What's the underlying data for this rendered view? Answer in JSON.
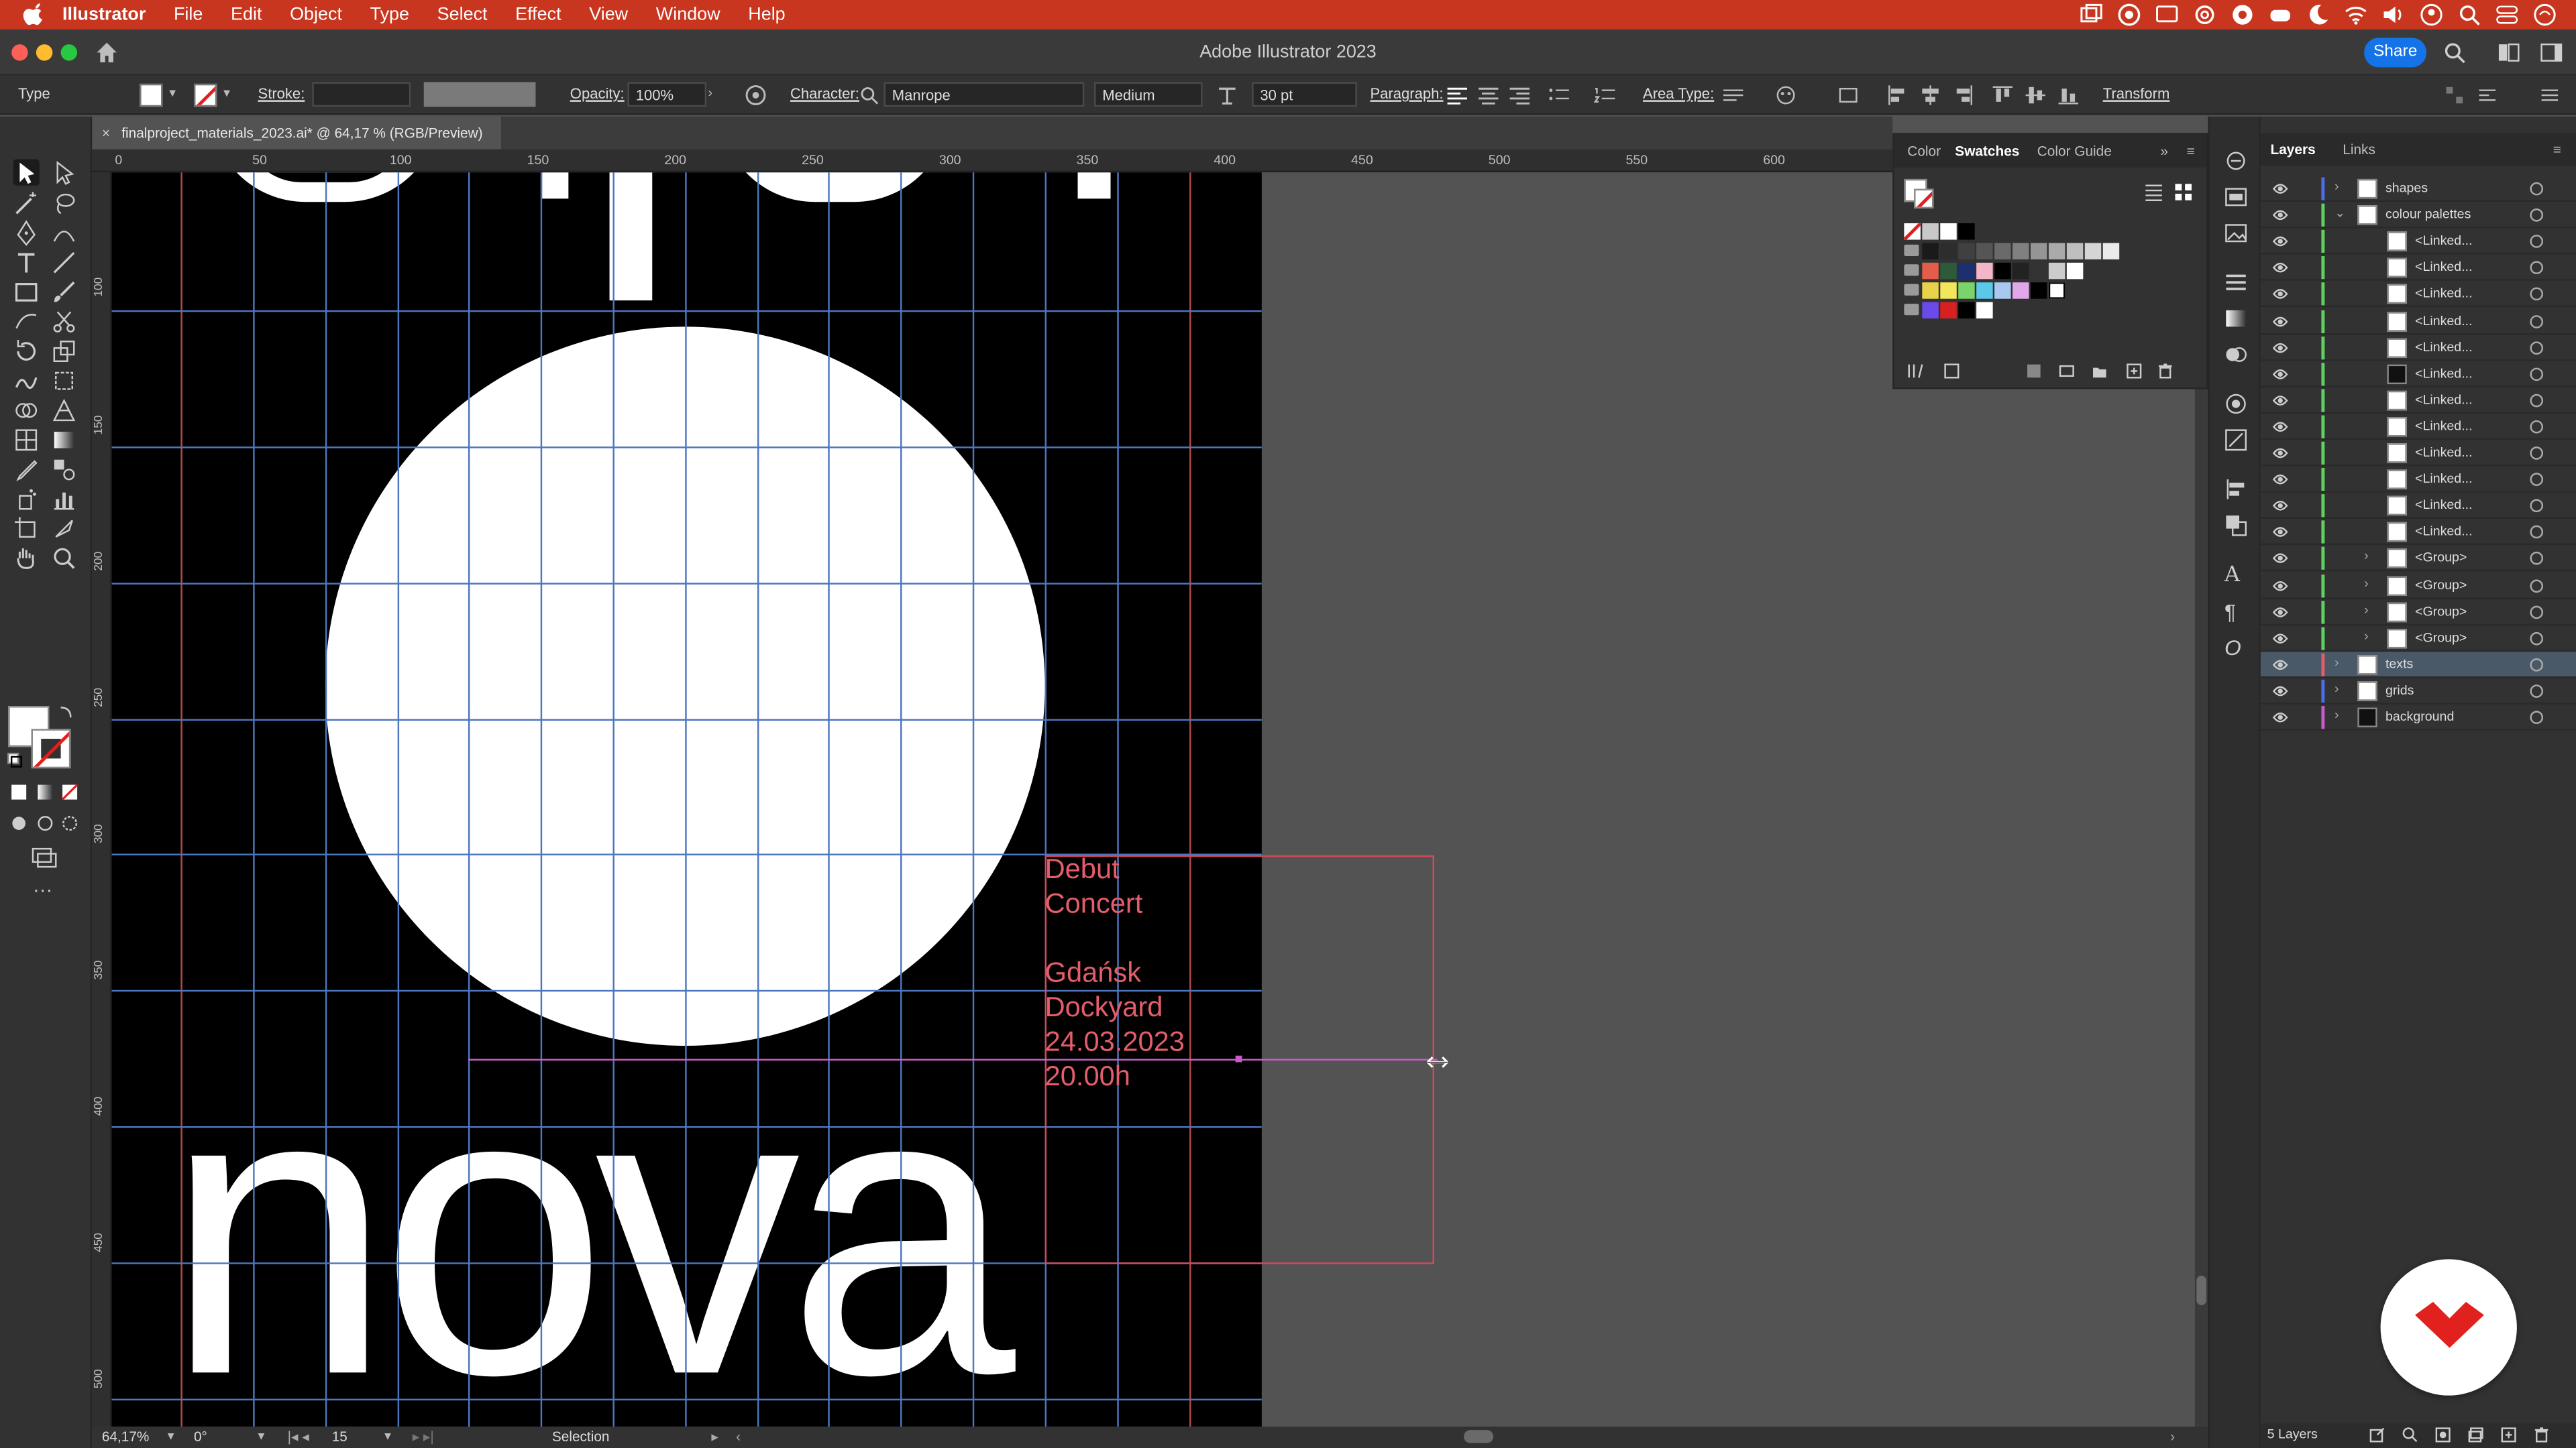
{
  "menubar": {
    "app": "Illustrator",
    "items": [
      "File",
      "Edit",
      "Object",
      "Type",
      "Select",
      "Effect",
      "View",
      "Window",
      "Help"
    ]
  },
  "window": {
    "title": "Adobe Illustrator 2023",
    "share": "Share"
  },
  "control": {
    "tool": "Type",
    "stroke": "Stroke:",
    "opacity_label": "Opacity:",
    "opacity": "100%",
    "character_label": "Character:",
    "font": "Manrope",
    "weight": "Medium",
    "size": "30 pt",
    "paragraph_label": "Paragraph:",
    "area_type_label": "Area Type:",
    "transform": "Transform"
  },
  "document": {
    "tab": "finalproject_materials_2023.ai* @ 64,17 % (RGB/Preview)"
  },
  "ruler": {
    "h_ticks": [
      "0",
      "50",
      "100",
      "150",
      "200",
      "250",
      "300",
      "350",
      "400",
      "450",
      "500",
      "550",
      "600"
    ]
  },
  "artwork": {
    "headline": "nova",
    "lines": [
      "Debut",
      "Concert",
      "",
      "Gdańsk",
      "Dockyard",
      "24.03.2023",
      "20.00h"
    ]
  },
  "status": {
    "zoom": "64,17%",
    "rotation": "0°",
    "artboard": "15",
    "tool": "Selection"
  },
  "swatches": {
    "tabs": [
      "Color",
      "Swatches",
      "Color Guide"
    ]
  },
  "layers": {
    "tabs": [
      "Layers",
      "Links"
    ],
    "footer": "5 Layers",
    "rows": [
      {
        "name": "shapes",
        "indent": 0,
        "expand": "›",
        "color": "#4c6ee6",
        "thumb": "light"
      },
      {
        "name": "colour palettes",
        "indent": 0,
        "expand": "⌄",
        "color": "#5fd35f",
        "thumb": "light"
      },
      {
        "name": "<Linked...",
        "indent": 1,
        "expand": "",
        "color": "#5fd35f",
        "thumb": "light"
      },
      {
        "name": "<Linked...",
        "indent": 1,
        "expand": "",
        "color": "#5fd35f",
        "thumb": "light"
      },
      {
        "name": "<Linked...",
        "indent": 1,
        "expand": "",
        "color": "#5fd35f",
        "thumb": "light"
      },
      {
        "name": "<Linked...",
        "indent": 1,
        "expand": "",
        "color": "#5fd35f",
        "thumb": "light"
      },
      {
        "name": "<Linked...",
        "indent": 1,
        "expand": "",
        "color": "#5fd35f",
        "thumb": "light"
      },
      {
        "name": "<Linked...",
        "indent": 1,
        "expand": "",
        "color": "#5fd35f",
        "thumb": "dark"
      },
      {
        "name": "<Linked...",
        "indent": 1,
        "expand": "",
        "color": "#5fd35f",
        "thumb": "light"
      },
      {
        "name": "<Linked...",
        "indent": 1,
        "expand": "",
        "color": "#5fd35f",
        "thumb": "light"
      },
      {
        "name": "<Linked...",
        "indent": 1,
        "expand": "",
        "color": "#5fd35f",
        "thumb": "light"
      },
      {
        "name": "<Linked...",
        "indent": 1,
        "expand": "",
        "color": "#5fd35f",
        "thumb": "light"
      },
      {
        "name": "<Linked...",
        "indent": 1,
        "expand": "",
        "color": "#5fd35f",
        "thumb": "light"
      },
      {
        "name": "<Linked...",
        "indent": 1,
        "expand": "",
        "color": "#5fd35f",
        "thumb": "light"
      },
      {
        "name": "<Group>",
        "indent": 1,
        "expand": "›",
        "color": "#5fd35f",
        "thumb": "light"
      },
      {
        "name": "<Group>",
        "indent": 1,
        "expand": "›",
        "color": "#5fd35f",
        "thumb": "light"
      },
      {
        "name": "<Group>",
        "indent": 1,
        "expand": "›",
        "color": "#5fd35f",
        "thumb": "light"
      },
      {
        "name": "<Group>",
        "indent": 1,
        "expand": "›",
        "color": "#5fd35f",
        "thumb": "light"
      },
      {
        "name": "texts",
        "indent": 0,
        "expand": "›",
        "color": "#e35d6a",
        "thumb": "light",
        "selected": true
      },
      {
        "name": "grids",
        "indent": 0,
        "expand": "›",
        "color": "#4c6ee6",
        "thumb": "light"
      },
      {
        "name": "background",
        "indent": 0,
        "expand": "›",
        "color": "#c85cc8",
        "thumb": "dark"
      }
    ]
  },
  "colors": {
    "menubar": "#c8361f",
    "accent": "#1473e6",
    "text_frame": "#d44a5a",
    "badge": "#e0211d"
  }
}
